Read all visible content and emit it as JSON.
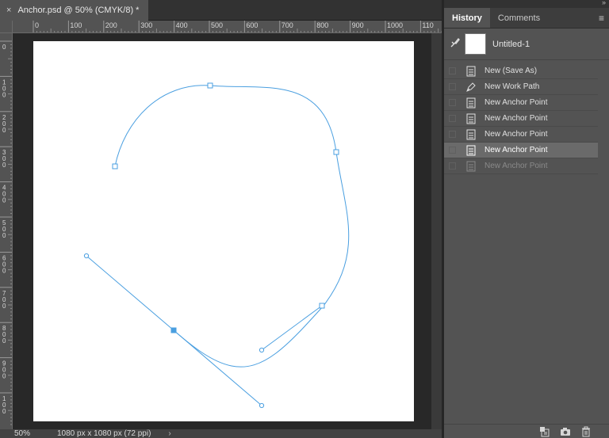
{
  "document": {
    "tab_title": "Anchor.psd @ 50% (CMYK/8) *",
    "close_glyph": "×",
    "zoom": "50%",
    "doc_size": "1080 px x 1080 px (72 ppi)",
    "status_arrow": "›"
  },
  "rulers": {
    "top_labels": [
      "0",
      "100",
      "200",
      "300",
      "400",
      "500",
      "600",
      "700",
      "800",
      "900",
      "1000",
      "110"
    ],
    "left_labels": [
      "0",
      "100",
      "200",
      "300",
      "400",
      "500",
      "600",
      "700",
      "800",
      "900",
      "100"
    ]
  },
  "panel": {
    "collapse_glyph": "»",
    "tabs": [
      {
        "label": "History",
        "active": true
      },
      {
        "label": "Comments",
        "active": false
      }
    ],
    "menu_icon": "panel-menu-icon",
    "snapshot_label": "Untitled-1",
    "items": [
      {
        "label": "New (Save As)",
        "icon": "document-icon"
      },
      {
        "label": "New Work Path",
        "icon": "pen-icon"
      },
      {
        "label": "New Anchor Point",
        "icon": "document-icon"
      },
      {
        "label": "New Anchor Point",
        "icon": "document-icon"
      },
      {
        "label": "New Anchor Point",
        "icon": "document-icon"
      },
      {
        "label": "New Anchor Point",
        "icon": "document-icon",
        "selected": true
      },
      {
        "label": "New Anchor Point",
        "icon": "document-icon",
        "dimmed": true
      }
    ],
    "footer_icons": [
      "new-document-from-state-icon",
      "camera-icon",
      "trash-icon"
    ]
  },
  "colors": {
    "path": "#4a9fe0",
    "selection": "#6a6a6a"
  }
}
